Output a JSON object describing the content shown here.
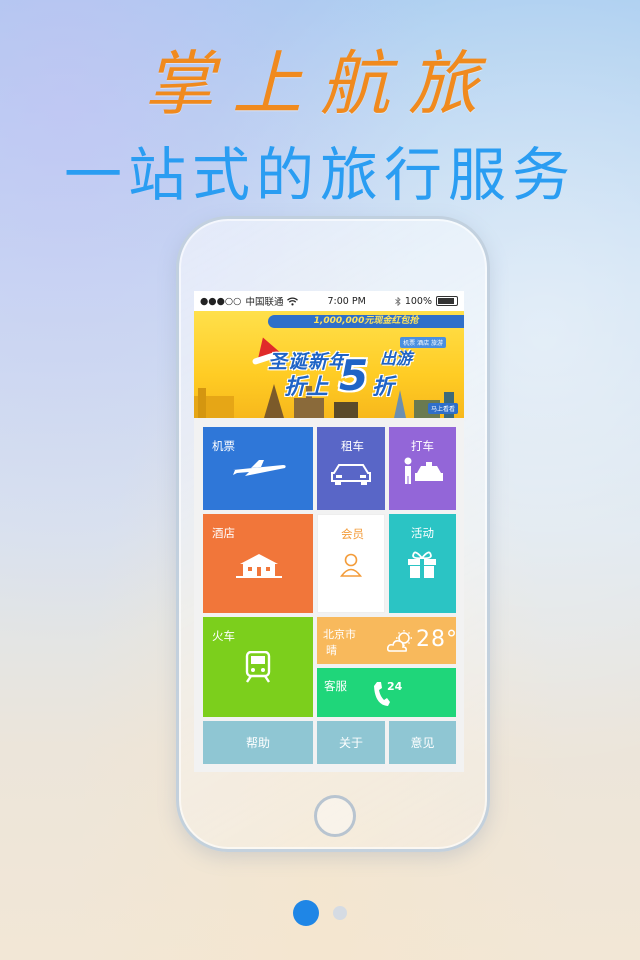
{
  "promo": {
    "headline": "掌上航旅",
    "subline": "一站式的旅行服务"
  },
  "status_bar": {
    "signal": "●●●○○",
    "carrier": "中国联通",
    "wifi_icon": "wifi-icon",
    "time": "7:00 PM",
    "bluetooth_icon": "bluetooth-icon",
    "battery": "100%"
  },
  "banner": {
    "strip_text": "1,000,000元现金红包抢",
    "tags": "机票 酒店 旅游",
    "title_line1": "圣诞新年",
    "title_line2": "折上",
    "big_number": "5",
    "zhe": "折",
    "go": "出游",
    "corner": "马上看看"
  },
  "tiles": {
    "flight": {
      "label": "机票",
      "color": "#2f77d8",
      "icon": "airplane-icon"
    },
    "car_rental": {
      "label": "租车",
      "color": "#5966c7",
      "icon": "car-icon"
    },
    "taxi": {
      "label": "打车",
      "color": "#9366d8",
      "icon": "taxi-icon"
    },
    "hotel": {
      "label": "酒店",
      "color": "#f1763a",
      "icon": "house-icon"
    },
    "member": {
      "label": "会员",
      "color": "#ffffff",
      "text_color": "#f39c3a",
      "icon": "person-icon"
    },
    "activity": {
      "label": "活动",
      "color": "#2bc4c4",
      "icon": "gift-icon"
    },
    "train": {
      "label": "火车",
      "color": "#7ccf1c",
      "icon": "train-icon"
    },
    "weather": {
      "city": "北京市",
      "condition": "晴",
      "temp": "28°",
      "color": "#f8b95c",
      "icon": "cloud-sun-icon"
    },
    "service": {
      "label": "客服",
      "number": "24",
      "color": "#1fd67a",
      "icon": "phone-icon"
    },
    "help": {
      "label": "帮助",
      "color": "#8fc6d3"
    },
    "about": {
      "label": "关于",
      "color": "#8fc6d3"
    },
    "feedback": {
      "label": "意见",
      "color": "#8fc6d3"
    }
  },
  "pagination": {
    "pages": 2,
    "active": 1
  }
}
